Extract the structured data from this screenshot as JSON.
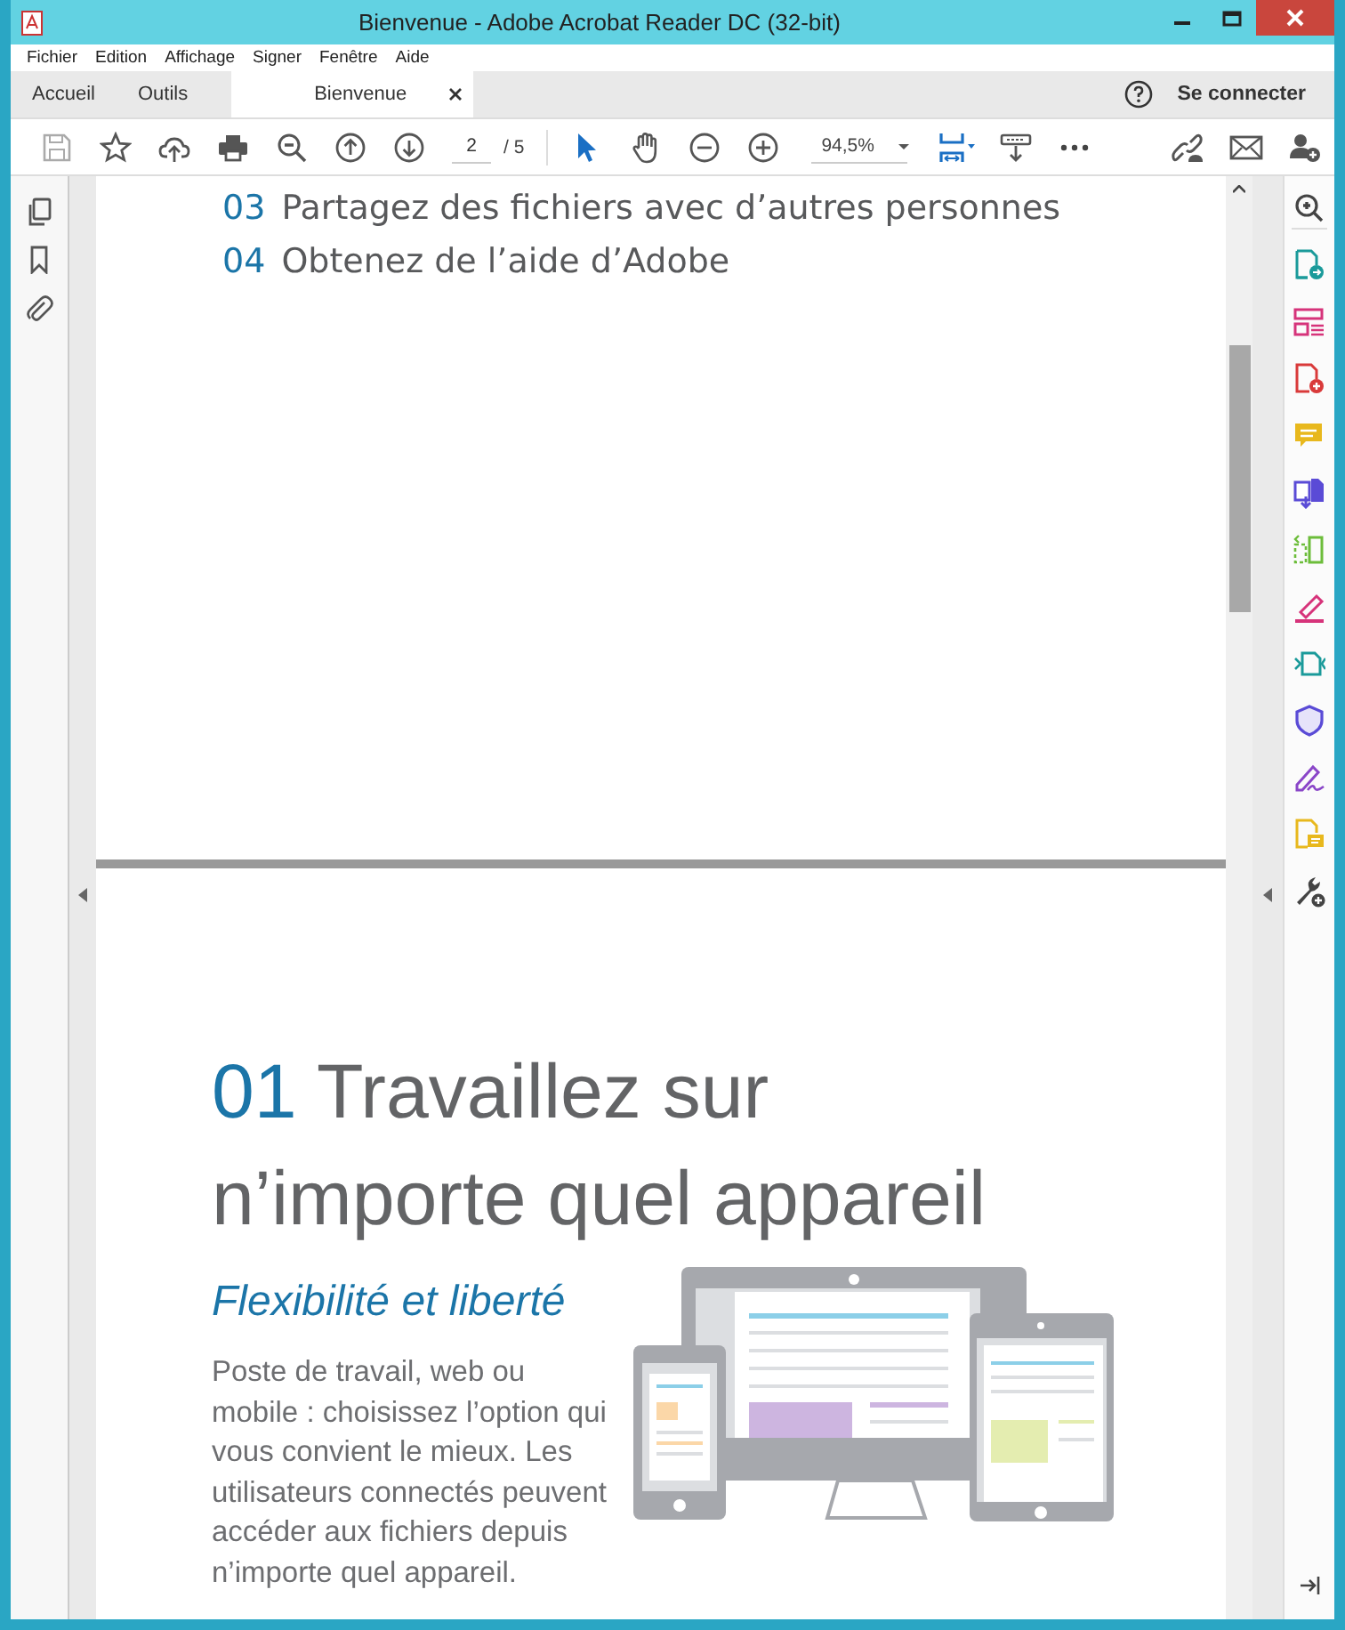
{
  "window": {
    "title": "Bienvenue - Adobe Acrobat Reader DC (32-bit)"
  },
  "menu": [
    "Fichier",
    "Edition",
    "Affichage",
    "Signer",
    "Fenêtre",
    "Aide"
  ],
  "tabs": [
    {
      "label": "Accueil",
      "selected": false
    },
    {
      "label": "Outils",
      "selected": false
    },
    {
      "label": "Bienvenue",
      "selected": true
    }
  ],
  "account": {
    "sign_in": "Se connecter"
  },
  "toolbar": {
    "page_number": "2",
    "page_total": "/ 5",
    "zoom": "94,5%",
    "tools": [
      {
        "kind": "select",
        "selected": true
      },
      {
        "kind": "hand",
        "selected": false
      }
    ]
  },
  "document": {
    "contents": [
      {
        "number": "03",
        "text": "Partagez des fichiers avec d’autres personnes"
      },
      {
        "number": "04",
        "text": "Obtenez de l’aide d’Adobe"
      }
    ],
    "section": {
      "number": "01",
      "title": "Travaillez sur n’importe quel appareil",
      "subtitle": "Flexibilité et liberté",
      "body": "Poste de travail, web ou mobile : choisissez l’option qui vous convient le mieux. Les utilisateurs connectés peuvent accéder aux fichiers depuis n’importe quel appareil."
    }
  }
}
